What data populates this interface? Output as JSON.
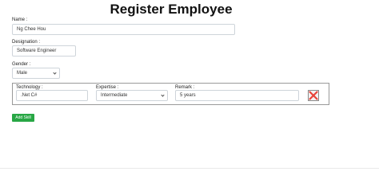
{
  "page": {
    "title": "Register Employee"
  },
  "form": {
    "name": {
      "label": "Name :",
      "value": "Ng Chee Hou"
    },
    "designation": {
      "label": "Designation :",
      "value": "Software Engineer"
    },
    "gender": {
      "label": "Gender :",
      "value": "Male"
    }
  },
  "skills": [
    {
      "technology": {
        "label": "Technology :",
        "value": ".Net C#"
      },
      "expertise": {
        "label": "Expertise :",
        "value": "Intermediate"
      },
      "remark": {
        "label": "Remark :",
        "value": "5 years"
      },
      "remove_icon": "red-x-close-icon",
      "remove_color": "#e8443a"
    }
  ],
  "actions": {
    "add_skill_label": "Add Skill",
    "add_skill_color": "#28a745"
  }
}
